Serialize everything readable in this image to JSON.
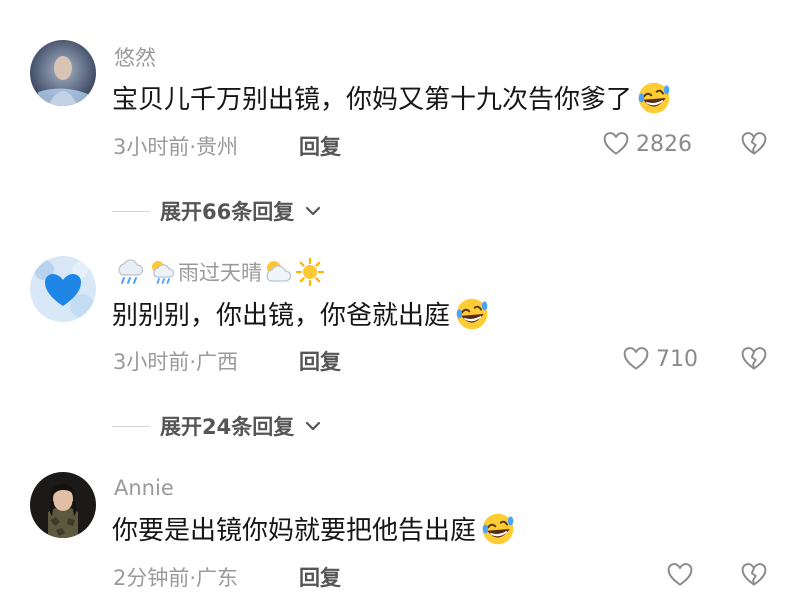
{
  "comments": [
    {
      "username": "悠然",
      "text": "宝贝儿千万别出镜，你妈又第十九次告你爹了",
      "time_location": "3小时前·贵州",
      "reply_label": "回复",
      "likes": "2826",
      "expand_label": "展开66条回复"
    },
    {
      "username": "雨过天晴",
      "text": "别别别，你出镜，你爸就出庭",
      "time_location": "3小时前·广西",
      "reply_label": "回复",
      "likes": "710",
      "expand_label": "展开24条回复"
    },
    {
      "username": "Annie",
      "text": "你要是出镜你妈就要把他告出庭",
      "time_location": "2分钟前·广东",
      "reply_label": "回复",
      "likes": ""
    }
  ],
  "icons": {
    "emoji": "rolling-on-floor-laughing",
    "weather": [
      "rain-cloud",
      "sun-behind-rain-cloud",
      "sun-behind-cloud",
      "sun"
    ]
  },
  "colors": {
    "primary_text": "#161616",
    "secondary_text": "#9a9a9a",
    "action_text": "#555555"
  }
}
